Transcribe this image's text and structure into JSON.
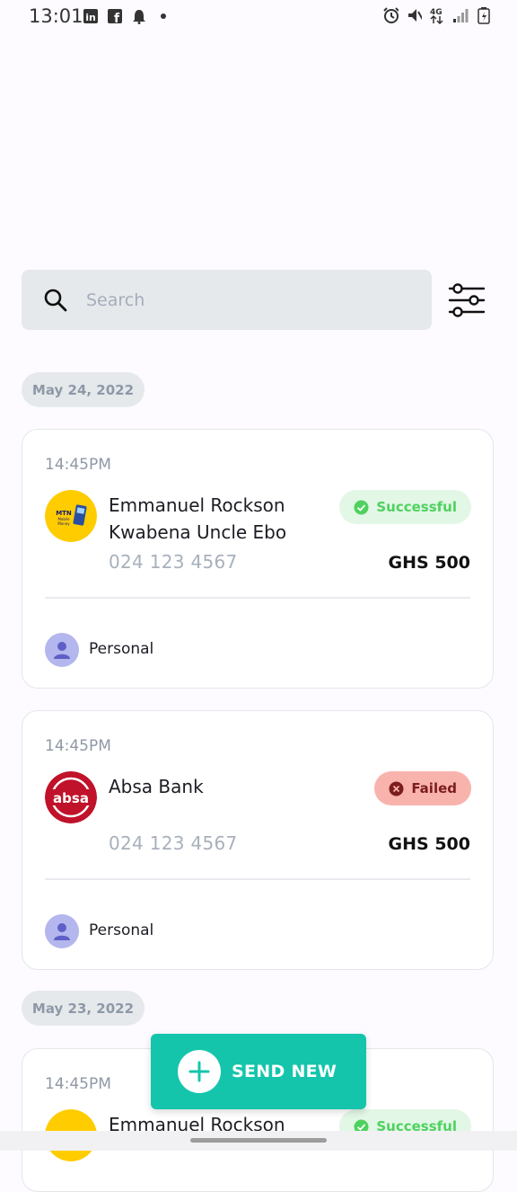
{
  "status_bar": {
    "time": "13:01",
    "network": "4G"
  },
  "search": {
    "placeholder": "Search"
  },
  "groups": [
    {
      "date": "May 24, 2022",
      "transactions": [
        {
          "time": "14:45PM",
          "recipient": "Emmanuel Rockson Kwabena Uncle Ebo",
          "provider": "MTN Mobile Money",
          "logo_text": "MTN Mobile Money",
          "phone": "024 123 4567",
          "amount": "GHS 500",
          "status": "Successful",
          "category": "Personal"
        },
        {
          "time": "14:45PM",
          "recipient": "Absa Bank",
          "provider": "Absa",
          "logo_text": "absa",
          "phone": "024 123 4567",
          "amount": "GHS 500",
          "status": "Failed",
          "category": "Personal"
        }
      ]
    },
    {
      "date": "May 23, 2022",
      "transactions": [
        {
          "time": "14:45PM",
          "recipient": "Emmanuel Rockson",
          "provider": "MTN Mobile Money",
          "status": "Successful"
        }
      ]
    }
  ],
  "fab": {
    "label": "SEND NEW"
  },
  "colors": {
    "accent": "#14c5ac",
    "success": "#4fd15f",
    "failed": "#7c1d1d",
    "mtn_yellow": "#ffcc00",
    "absa_red": "#c0122a"
  }
}
